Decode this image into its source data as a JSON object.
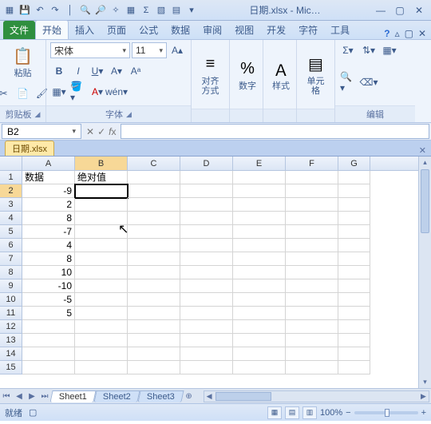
{
  "window": {
    "title": "日期.xlsx - Mic…"
  },
  "tabs": {
    "file": "文件",
    "home": "开始",
    "insert": "插入",
    "layout": "页面",
    "formula": "公式",
    "data": "数据",
    "review": "审阅",
    "view": "视图",
    "dev": "开发",
    "chars": "字符",
    "tools": "工具"
  },
  "ribbon": {
    "clipboard": {
      "paste": "粘贴",
      "label": "剪贴板"
    },
    "font": {
      "name": "宋体",
      "size": "11",
      "label": "字体"
    },
    "align": {
      "label": "对齐方式"
    },
    "number": {
      "label": "数字"
    },
    "styles": {
      "label": "样式"
    },
    "cells": {
      "label": "单元格"
    },
    "editing": {
      "label": "编辑"
    }
  },
  "namebox": "B2",
  "formula": "",
  "workbook_tab": "日期.xlsx",
  "columns": [
    "A",
    "B",
    "C",
    "D",
    "E",
    "F",
    "G"
  ],
  "grid": {
    "headers": {
      "A1": "数据",
      "B1": "绝对值"
    },
    "colA": [
      "-9",
      "2",
      "8",
      "-7",
      "4",
      "8",
      "10",
      "-10",
      "-5",
      "5"
    ]
  },
  "active_cell": "B2",
  "sheets": [
    "Sheet1",
    "Sheet2",
    "Sheet3"
  ],
  "status": {
    "ready": "就绪",
    "macro": "",
    "zoom": "100%"
  },
  "chart_data": {
    "type": "table",
    "title": "",
    "columns": [
      "数据",
      "绝对值"
    ],
    "rows": [
      [
        -9,
        null
      ],
      [
        2,
        null
      ],
      [
        8,
        null
      ],
      [
        -7,
        null
      ],
      [
        4,
        null
      ],
      [
        8,
        null
      ],
      [
        10,
        null
      ],
      [
        -10,
        null
      ],
      [
        -5,
        null
      ],
      [
        5,
        null
      ]
    ]
  }
}
